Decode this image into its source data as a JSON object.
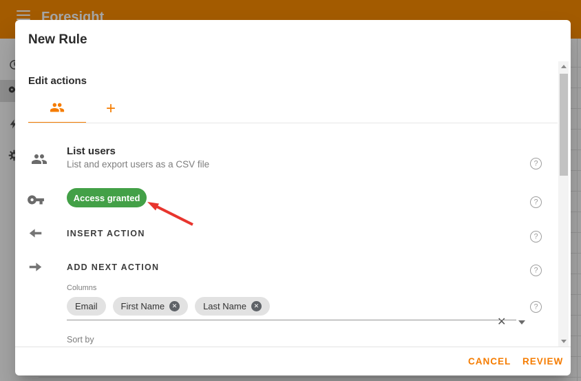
{
  "topbar": {
    "title": "Foresight"
  },
  "colors": {
    "topbar_orange": "#FB8C00",
    "accent_orange": "#F57C00",
    "success_green": "#43A047",
    "arrow_red": "#E8352E"
  },
  "icons": {
    "help_glyph": "?",
    "clear_glyph": "✕",
    "remove_glyph": "✕"
  },
  "modal": {
    "title": "New Rule",
    "section_title": "Edit actions",
    "tabs": [
      {
        "icon": "people-icon",
        "selected": true
      },
      {
        "icon": "plus-icon",
        "glyph": "+",
        "selected": false
      }
    ],
    "action_card": {
      "title": "List users",
      "subtitle": "List and export users as a CSV file"
    },
    "access_status": {
      "label": "Access granted"
    },
    "insert_action": {
      "label": "INSERT ACTION"
    },
    "add_next_action": {
      "label": "ADD NEXT ACTION"
    },
    "columns_field": {
      "label": "Columns",
      "chips": [
        {
          "label": "Email",
          "removable": false
        },
        {
          "label": "First Name",
          "removable": true
        },
        {
          "label": "Last Name",
          "removable": true
        }
      ]
    },
    "sort_by_field": {
      "label": "Sort by"
    },
    "footer": {
      "cancel_label": "CANCEL",
      "review_label": "REVIEW"
    }
  }
}
